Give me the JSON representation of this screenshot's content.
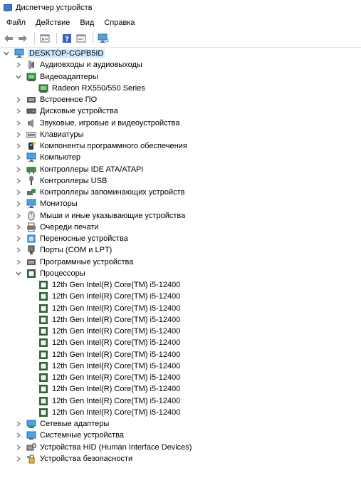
{
  "window": {
    "title": "Диспетчер устройств"
  },
  "menu": [
    "Файл",
    "Действие",
    "Вид",
    "Справка"
  ],
  "toolbar": {
    "buttons": [
      "back-arrow-icon",
      "forward-arrow-icon",
      "properties-icon",
      "help-icon",
      "update-driver-icon",
      "monitor-scan-icon"
    ]
  },
  "tree": {
    "root": {
      "label": "DESKTOP-CGPB5ID",
      "expanded": true,
      "selected": true
    },
    "categories": [
      {
        "label": "Аудиовходы и аудиовыходы",
        "icon": "audio-io-icon",
        "expanded": false
      },
      {
        "label": "Видеоадаптеры",
        "icon": "display-adapter-icon",
        "expanded": true,
        "children": [
          "Radeon RX550/550 Series"
        ]
      },
      {
        "label": "Встроенное ПО",
        "icon": "firmware-icon",
        "expanded": false
      },
      {
        "label": "Дисковые устройства",
        "icon": "disk-drive-icon",
        "expanded": false
      },
      {
        "label": "Звуковые, игровые и видеоустройства",
        "icon": "speaker-icon",
        "expanded": false
      },
      {
        "label": "Клавиатуры",
        "icon": "keyboard-icon",
        "expanded": false
      },
      {
        "label": "Компоненты программного обеспечения",
        "icon": "software-component-icon",
        "expanded": false
      },
      {
        "label": "Компьютер",
        "icon": "computer-icon",
        "expanded": false
      },
      {
        "label": "Контроллеры IDE ATA/ATAPI",
        "icon": "ide-controller-icon",
        "expanded": false
      },
      {
        "label": "Контроллеры USB",
        "icon": "usb-icon",
        "expanded": false
      },
      {
        "label": "Контроллеры запоминающих устройств",
        "icon": "storage-controller-icon",
        "expanded": false
      },
      {
        "label": "Мониторы",
        "icon": "monitor-icon",
        "expanded": false
      },
      {
        "label": "Мыши и иные указывающие устройства",
        "icon": "mouse-icon",
        "expanded": false
      },
      {
        "label": "Очереди печати",
        "icon": "printer-icon",
        "expanded": false
      },
      {
        "label": "Переносные устройства",
        "icon": "portable-device-icon",
        "expanded": false
      },
      {
        "label": "Порты (COM и LPT)",
        "icon": "port-icon",
        "expanded": false
      },
      {
        "label": "Программные устройства",
        "icon": "software-device-icon",
        "expanded": false
      },
      {
        "label": "Процессоры",
        "icon": "processor-icon",
        "expanded": true,
        "children": [
          "12th Gen Intel(R) Core(TM) i5-12400",
          "12th Gen Intel(R) Core(TM) i5-12400",
          "12th Gen Intel(R) Core(TM) i5-12400",
          "12th Gen Intel(R) Core(TM) i5-12400",
          "12th Gen Intel(R) Core(TM) i5-12400",
          "12th Gen Intel(R) Core(TM) i5-12400",
          "12th Gen Intel(R) Core(TM) i5-12400",
          "12th Gen Intel(R) Core(TM) i5-12400",
          "12th Gen Intel(R) Core(TM) i5-12400",
          "12th Gen Intel(R) Core(TM) i5-12400",
          "12th Gen Intel(R) Core(TM) i5-12400",
          "12th Gen Intel(R) Core(TM) i5-12400"
        ]
      },
      {
        "label": "Сетевые адаптеры",
        "icon": "network-adapter-icon",
        "expanded": false
      },
      {
        "label": "Системные устройства",
        "icon": "system-device-icon",
        "expanded": false
      },
      {
        "label": "Устройства HID (Human Interface Devices)",
        "icon": "hid-icon",
        "expanded": false
      },
      {
        "label": "Устройства безопасности",
        "icon": "security-device-icon",
        "expanded": false
      }
    ]
  }
}
